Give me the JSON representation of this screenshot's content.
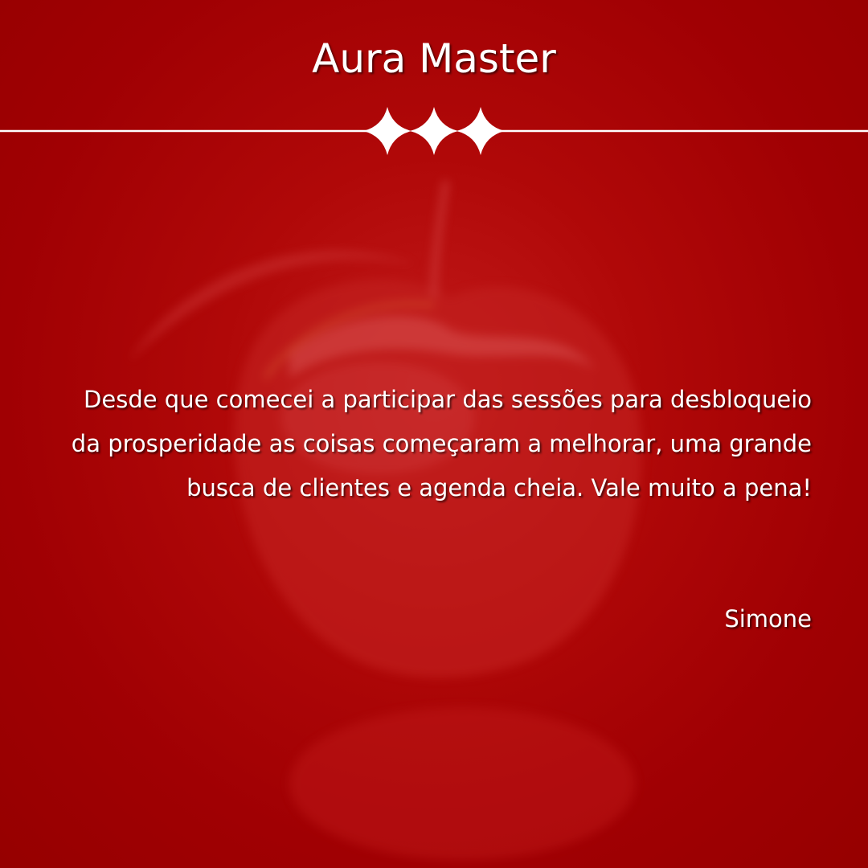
{
  "header": {
    "title": "Aura Master"
  },
  "decoration": {
    "divider_icon": "three-sparkles-icon",
    "background_image": "blurred-red-apple",
    "colors": {
      "background": "#a10002",
      "text": "#ffffff",
      "divider": "#ffffff"
    }
  },
  "testimonial": {
    "text": "Desde que comecei a participar das sessões para desbloqueio da prosperidade as coisas começaram a melhorar, uma grande busca de clientes e agenda cheia. Vale muito a pena!",
    "author": "Simone"
  }
}
